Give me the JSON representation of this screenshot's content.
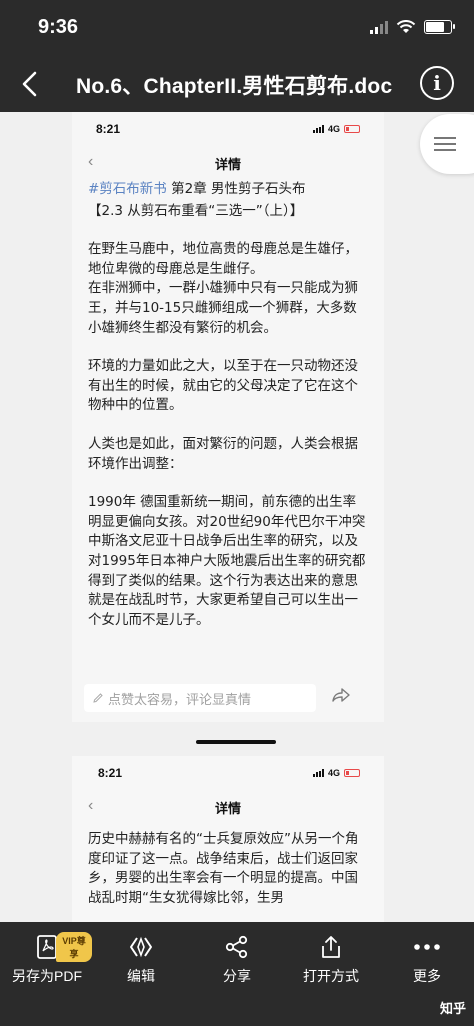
{
  "status": {
    "time": "9:36"
  },
  "header": {
    "title": "No.6、ChapterII.男性石剪布.doc"
  },
  "page1": {
    "time": "8:21",
    "network": "4G",
    "title": "详情",
    "hashtag": "#剪石布新书",
    "chapter": " 第2章 男性剪子石头布",
    "subtitle": "【2.3 从剪石布重看“三选一”（上）】",
    "paragraphs": [
      "在野生马鹿中，地位高贵的母鹿总是生雄仔，地位卑微的母鹿总是生雌仔。",
      "在非洲狮中，一群小雄狮中只有一只能成为狮王，并与10-15只雌狮组成一个狮群，大多数小雄狮终生都没有繁衍的机会。",
      "环境的力量如此之大，以至于在一只动物还没有出生的时候，就由它的父母决定了它在这个物种中的位置。",
      "人类也是如此，面对繁衍的问题，人类会根据环境作出调整：",
      "1990年 德国重新统一期间，前东德的出生率明显更偏向女孩。对20世纪90年代巴尔干冲突中斯洛文尼亚十日战争后出生率的研究，以及对1995年日本神户大阪地震后出生率的研究都得到了类似的结果。这个行为表达出来的意思就是在战乱时节，大家更希望自己可以生出一个女儿而不是儿子。"
    ],
    "comment_placeholder": "点赞太容易，评论显真情"
  },
  "page2": {
    "time": "8:21",
    "network": "4G",
    "title": "详情",
    "paragraph": "历史中赫赫有名的“士兵复原效应”从另一个角度印证了这一点。战争结束后，战士们返回家乡，男婴的出生率会有一个明显的提高。中国战乱时期“生女犹得嫁比邻，生男"
  },
  "toolbar": {
    "vip_badge": "VIP尊享",
    "items": [
      {
        "label": "另存为PDF",
        "icon": "pdf-icon"
      },
      {
        "label": "编辑",
        "icon": "edit-icon"
      },
      {
        "label": "分享",
        "icon": "share-icon"
      },
      {
        "label": "打开方式",
        "icon": "open-with-icon"
      },
      {
        "label": "更多",
        "icon": "more-icon"
      }
    ]
  },
  "watermark": {
    "text": "知乎"
  },
  "colors": {
    "header_bg": "#2b2b2b",
    "hashtag": "#5b83c2",
    "vip": "#f0c64a"
  }
}
